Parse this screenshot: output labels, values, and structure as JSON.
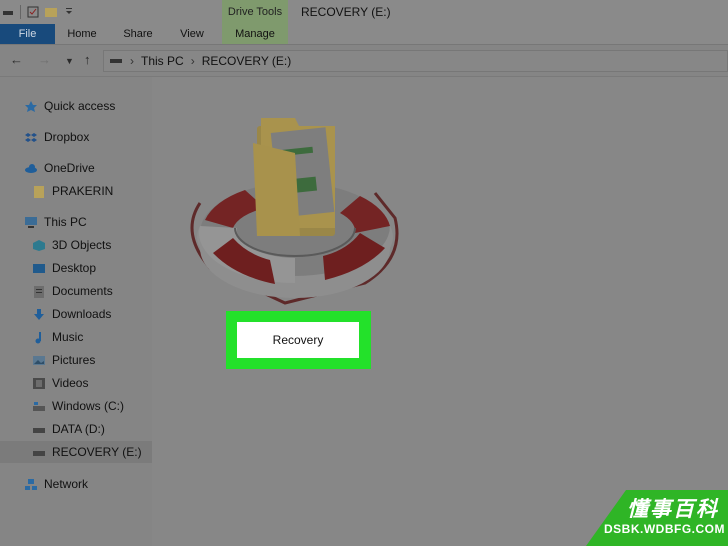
{
  "title_bar": {
    "context_tab": "Drive Tools",
    "window_title": "RECOVERY (E:)"
  },
  "ribbon": {
    "tabs": [
      "File",
      "Home",
      "Share",
      "View",
      "Manage"
    ]
  },
  "address_bar": {
    "path": [
      "This PC",
      "RECOVERY (E:)"
    ]
  },
  "sidebar": {
    "items": [
      {
        "label": "Quick access",
        "icon": "star-icon"
      },
      {
        "label": "Dropbox",
        "icon": "dropbox-icon"
      },
      {
        "label": "OneDrive",
        "icon": "cloud-icon"
      },
      {
        "label": "PRAKERIN",
        "icon": "folder-icon"
      },
      {
        "label": "This PC",
        "icon": "computer-icon"
      },
      {
        "label": "3D Objects",
        "icon": "cube-icon"
      },
      {
        "label": "Desktop",
        "icon": "desktop-icon"
      },
      {
        "label": "Documents",
        "icon": "documents-icon"
      },
      {
        "label": "Downloads",
        "icon": "download-icon"
      },
      {
        "label": "Music",
        "icon": "music-icon"
      },
      {
        "label": "Pictures",
        "icon": "pictures-icon"
      },
      {
        "label": "Videos",
        "icon": "videos-icon"
      },
      {
        "label": "Windows (C:)",
        "icon": "windows-drive-icon"
      },
      {
        "label": "DATA (D:)",
        "icon": "drive-icon"
      },
      {
        "label": "RECOVERY (E:)",
        "icon": "drive-icon"
      },
      {
        "label": "Network",
        "icon": "network-icon"
      }
    ],
    "selected": "RECOVERY (E:)"
  },
  "content": {
    "folder_label": "Recovery",
    "highlight_color": "#23e12a"
  },
  "watermark": {
    "brand_cn": "懂事百科",
    "url": "DSBK.WDBFG.COM"
  },
  "colors": {
    "file_tab": "#184a7c",
    "drive_tools": "#7f9a6d",
    "watermark_green": "#2fb526"
  }
}
